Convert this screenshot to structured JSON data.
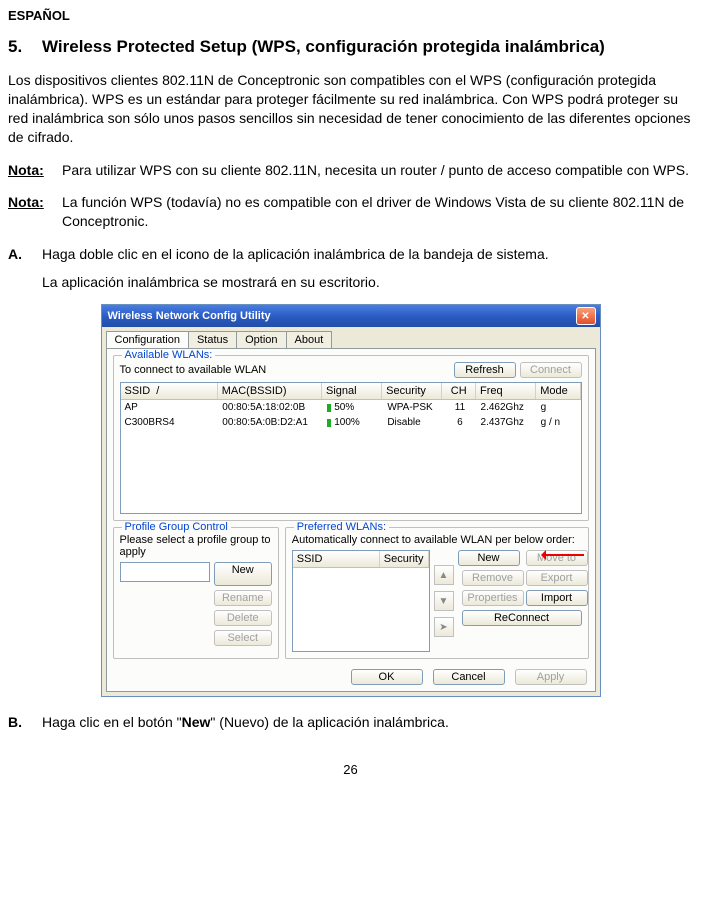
{
  "doc": {
    "language_label": "ESPAÑOL",
    "section_number": "5.",
    "section_title": "Wireless Protected Setup (WPS, configuración protegida inalámbrica)",
    "intro": "Los dispositivos clientes 802.11N de Conceptronic son compatibles con el WPS (configuración protegida inalámbrica). WPS es un estándar para proteger fácilmente su red inalámbrica. Con WPS podrá proteger su red inalámbrica son sólo unos pasos sencillos sin necesidad de tener conocimiento de las diferentes opciones de cifrado.",
    "note_label": "Nota:",
    "note1": "Para utilizar WPS con su cliente 802.11N, necesita un router / punto de acceso compatible con WPS.",
    "note2": "La función WPS (todavía) no es compatible con el driver de Windows Vista de su cliente 802.11N de Conceptronic.",
    "stepA_label": "A.",
    "stepA_text": "Haga doble clic en el icono de la aplicación inalámbrica de la bandeja de sistema.",
    "stepA_follow": "La aplicación inalámbrica se mostrará en su escritorio.",
    "stepB_label": "B.",
    "stepB_pre": "Haga clic en el botón \"",
    "stepB_bold": "New",
    "stepB_post": "\" (Nuevo) de la aplicación inalámbrica.",
    "page_number": "26"
  },
  "win": {
    "title": "Wireless Network Config Utility",
    "tabs": {
      "configuration": "Configuration",
      "status": "Status",
      "option": "Option",
      "about": "About"
    },
    "available": {
      "legend": "Available WLANs:",
      "connect_hint": "To connect to available WLAN",
      "refresh": "Refresh",
      "connect": "Connect",
      "cols": {
        "ssid": "SSID",
        "mac": "MAC(BSSID)",
        "signal": "Signal",
        "security": "Security",
        "ch": "CH",
        "freq": "Freq",
        "mode": "Mode"
      },
      "rows": [
        {
          "ssid": "AP",
          "mac": "00:80:5A:18:02:0B",
          "signal": "50%",
          "security": "WPA-PSK",
          "ch": "11",
          "freq": "2.462Ghz",
          "mode": "g"
        },
        {
          "ssid": "C300BRS4",
          "mac": "00:80:5A:0B:D2:A1",
          "signal": "100%",
          "security": "Disable",
          "ch": "6",
          "freq": "2.437Ghz",
          "mode": "g / n"
        }
      ]
    },
    "profile": {
      "legend": "Profile Group Control",
      "hint": "Please select a profile group to apply",
      "new": "New",
      "rename": "Rename",
      "delete": "Delete",
      "select": "Select"
    },
    "preferred": {
      "legend": "Preferred WLANs:",
      "hint": "Automatically connect to available WLAN per below order:",
      "col_ssid": "SSID",
      "col_security": "Security",
      "new": "New",
      "move_to": "Move to",
      "remove": "Remove",
      "export": "Export",
      "properties": "Properties",
      "import": "Import",
      "reconnect": "ReConnect"
    },
    "footer": {
      "ok": "OK",
      "cancel": "Cancel",
      "apply": "Apply"
    }
  }
}
